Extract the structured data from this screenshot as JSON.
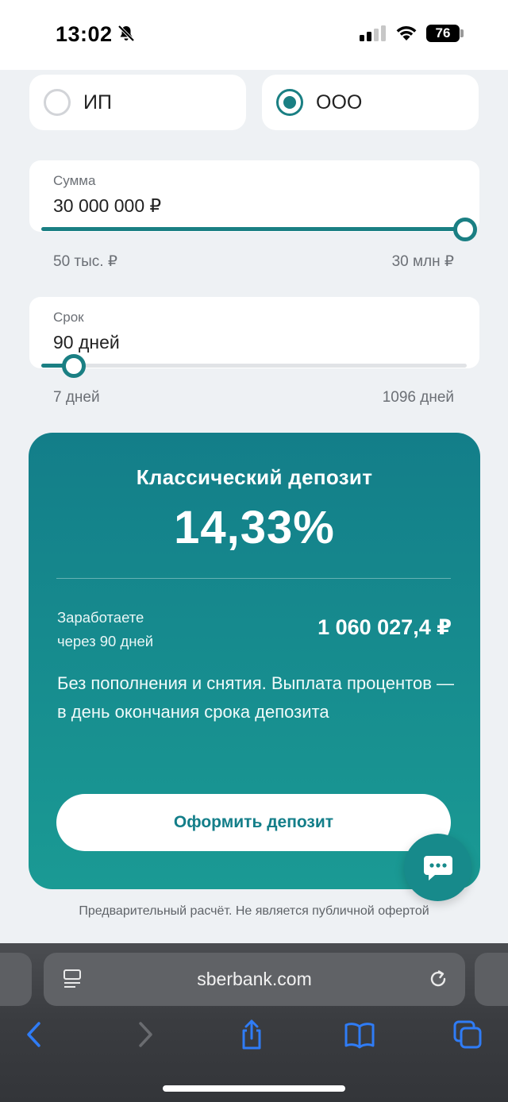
{
  "status_bar": {
    "time": "13:02",
    "battery": "76"
  },
  "entity_type": {
    "options": [
      {
        "label": "ИП",
        "selected": false
      },
      {
        "label": "ООО",
        "selected": true
      }
    ]
  },
  "amount": {
    "caption": "Сумма",
    "value": "30 000 000 ₽",
    "min_label": "50 тыс. ₽",
    "max_label": "30 млн ₽",
    "slider_fraction": 1.0
  },
  "term": {
    "caption": "Срок",
    "value": "90 дней",
    "min_label": "7 дней",
    "max_label": "1096 дней",
    "slider_fraction": 0.076
  },
  "result": {
    "title": "Классический депозит",
    "rate": "14,33%",
    "earn_label_line1": "Заработаете",
    "earn_label_line2": "через 90 дней",
    "earn_amount": "1 060 027,4 ₽",
    "description": "Без пополнения и снятия. Выплата процентов — в день окончания срока депозита",
    "cta_label": "Оформить депозит"
  },
  "disclaimer": "Предварительный расчёт. Не является публичной офертой",
  "browser": {
    "url": "sberbank.com"
  },
  "colors": {
    "accent": "#1a7f83",
    "card_gradient_top": "#137e89",
    "card_gradient_bottom": "#1a9a94",
    "safari_blue": "#2f7cf6"
  },
  "icons": [
    "bell-slash-icon",
    "cellular-signal-icon",
    "wifi-icon",
    "reader-mode-icon",
    "reload-icon",
    "back-icon",
    "forward-icon",
    "share-icon",
    "bookmarks-icon",
    "tabs-icon",
    "chat-icon"
  ]
}
